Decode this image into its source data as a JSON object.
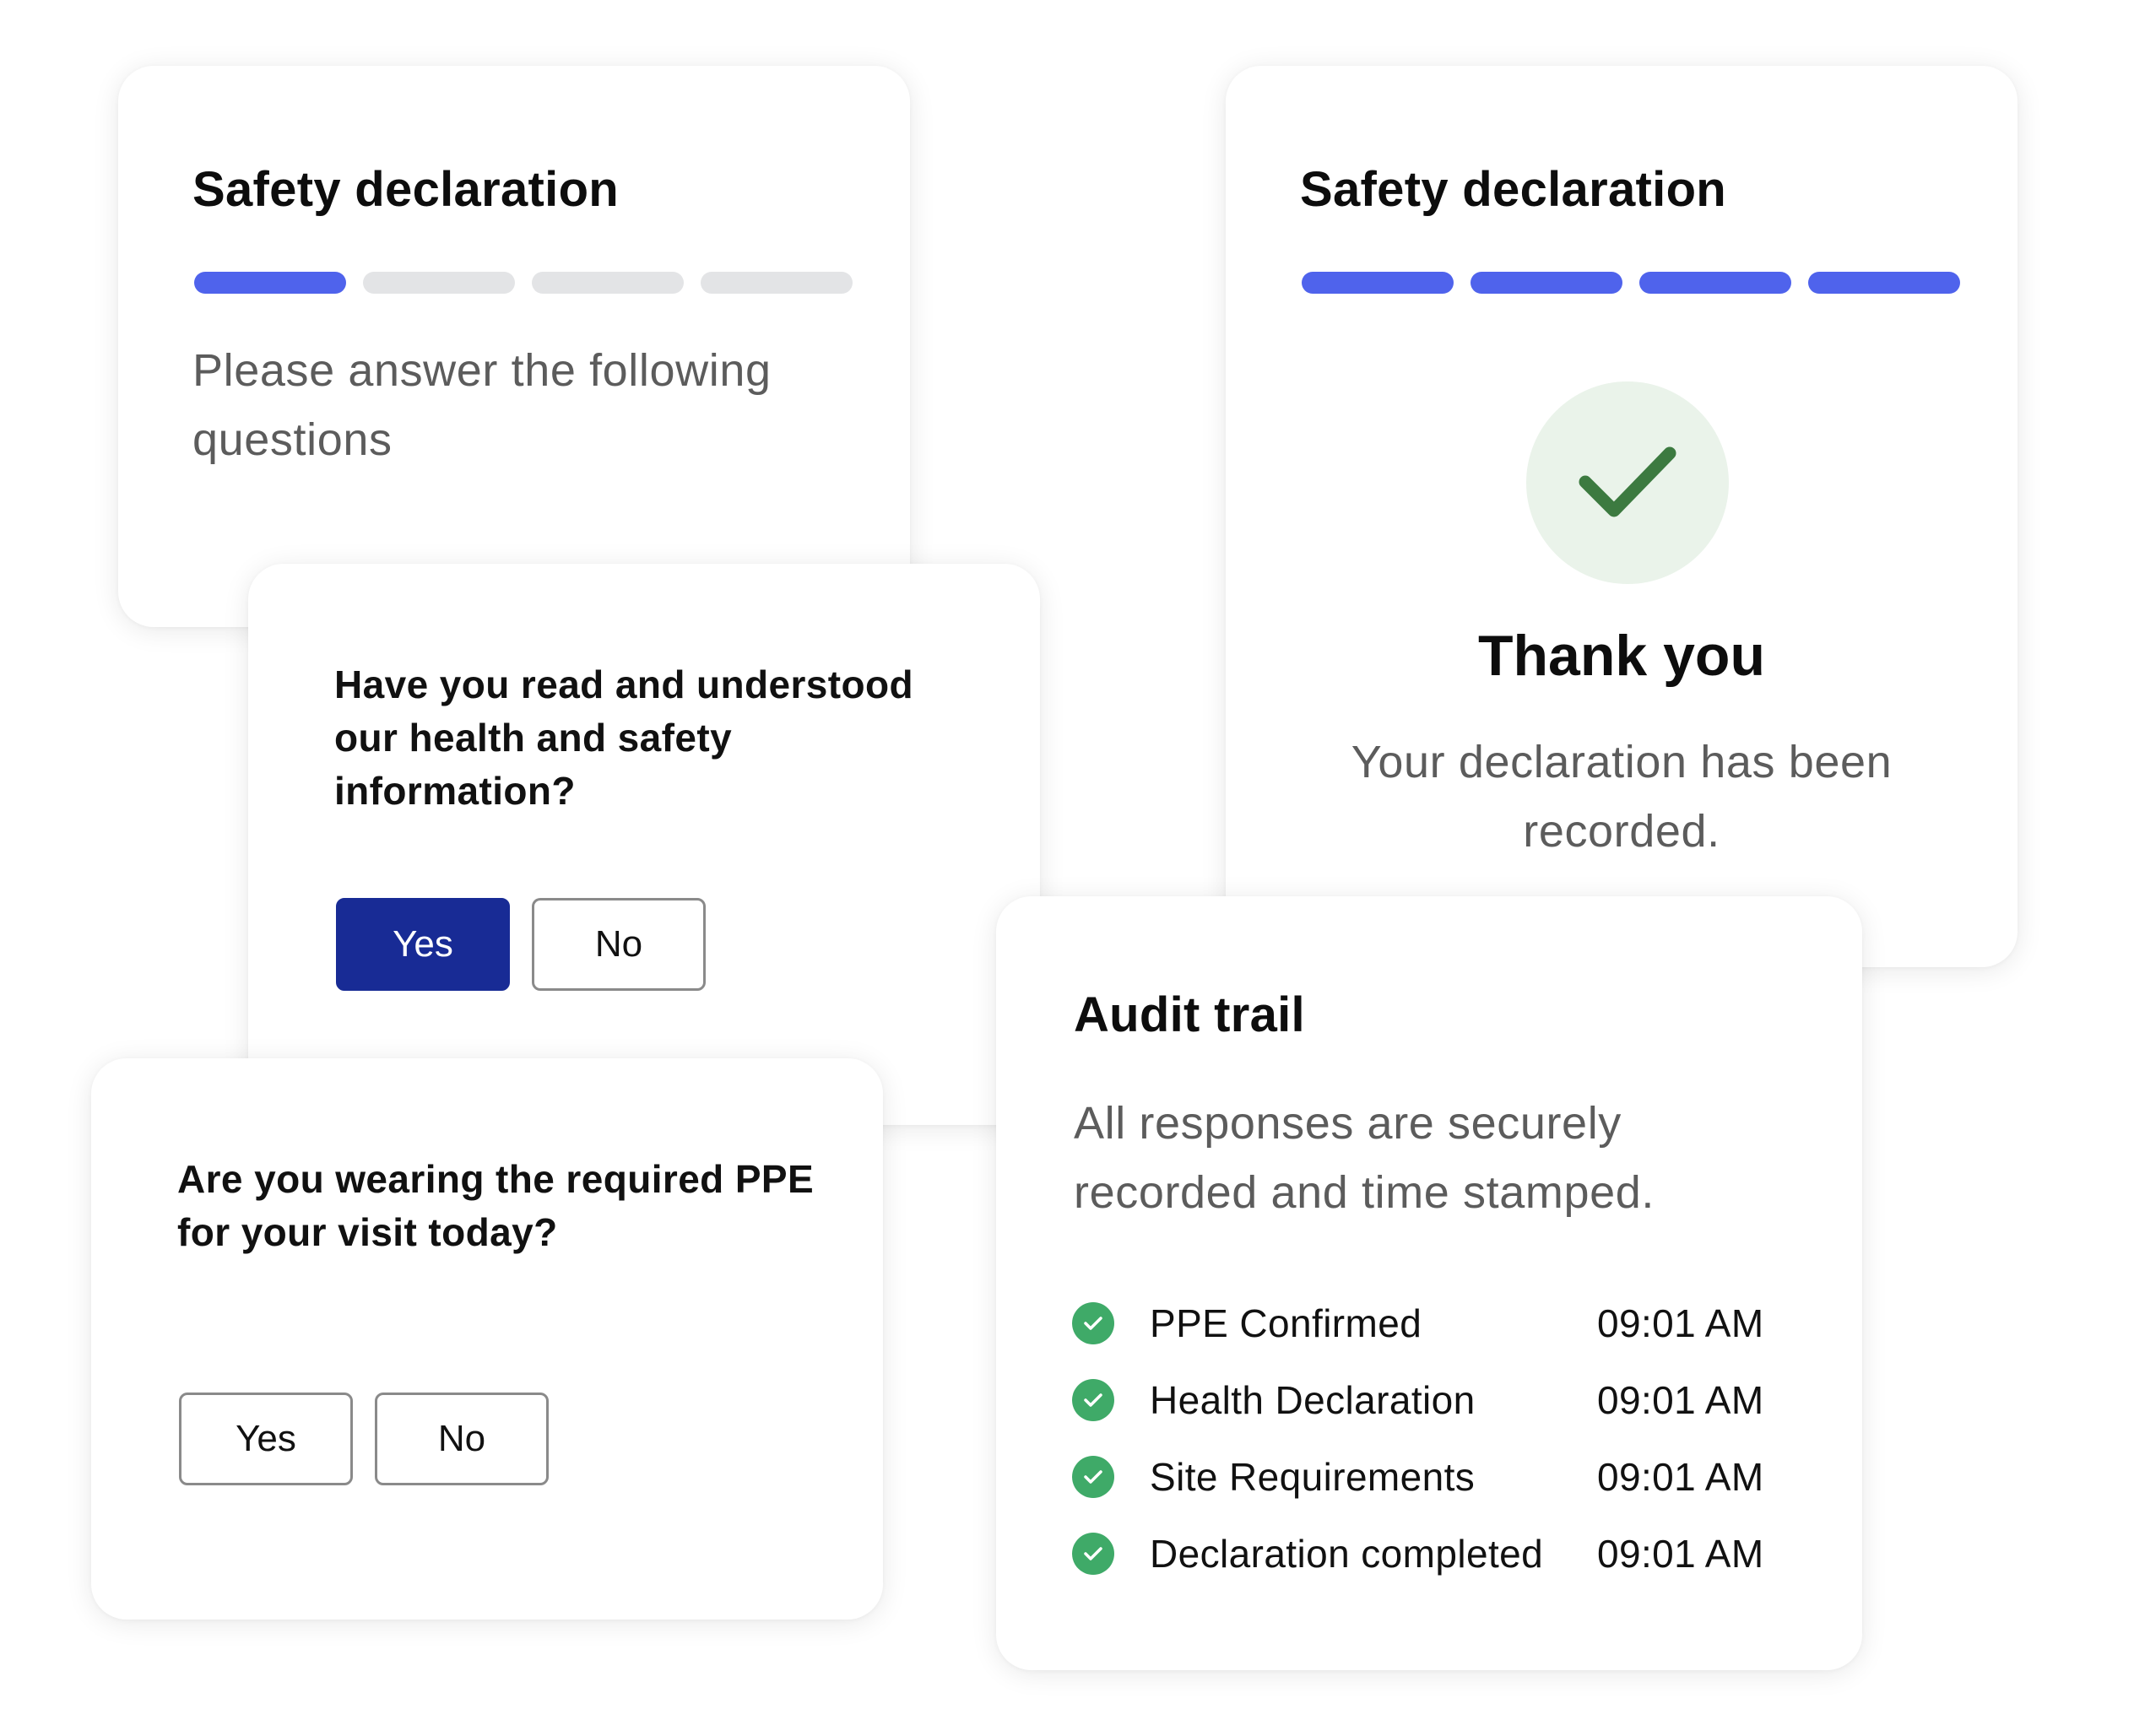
{
  "intro_card": {
    "title": "Safety declaration",
    "progress_steps_total": 4,
    "progress_steps_done": 1,
    "subtitle": "Please answer the following questions"
  },
  "question_one": {
    "text": "Have you read and understood our health and safety information?",
    "yes_label": "Yes",
    "no_label": "No",
    "selected": "Yes"
  },
  "question_two": {
    "text": "Are you wearing the required PPE for your visit today?",
    "yes_label": "Yes",
    "no_label": "No",
    "selected": null
  },
  "done_card": {
    "title": "Safety declaration",
    "progress_steps_total": 4,
    "progress_steps_done": 4,
    "icon": "checkmark-icon",
    "heading": "Thank you",
    "message": "Your declaration has been recorded."
  },
  "audit_card": {
    "title": "Audit trail",
    "subtitle": "All responses are securely recorded and time stamped.",
    "entries": [
      {
        "label": "PPE Confirmed",
        "time": "09:01 AM"
      },
      {
        "label": "Health Declaration",
        "time": "09:01 AM"
      },
      {
        "label": "Site Requirements",
        "time": "09:01 AM"
      },
      {
        "label": "Declaration completed",
        "time": "09:01 AM"
      }
    ]
  },
  "colors": {
    "progress_active": "#4f63ec",
    "progress_inactive": "#e3e4e6",
    "button_selected": "#182b95",
    "success_green": "#3faa68",
    "check_dark_green": "#3c7a40",
    "check_circle_bg": "#eaf3ea"
  }
}
